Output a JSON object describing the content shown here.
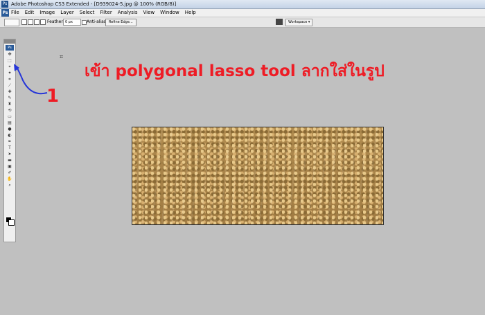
{
  "window": {
    "title": "Adobe Photoshop CS3 Extended - [D939024-5.jpg @ 100% (RGB/8)]",
    "app_badge": "Ps"
  },
  "menu": {
    "items": [
      "File",
      "Edit",
      "Image",
      "Layer",
      "Select",
      "Filter",
      "Analysis",
      "View",
      "Window",
      "Help"
    ]
  },
  "options": {
    "feather_label": "Feather:",
    "feather_value": "0 px",
    "anti_alias_label": "Anti-alias",
    "anti_alias_checked": true,
    "refine_edge_label": "Refine Edge...",
    "workspace_label": "Workspace ▾"
  },
  "toolbox": {
    "badge": "Ps",
    "tools": [
      "move-tool",
      "marquee-tool",
      "polygonal-lasso-tool",
      "magic-wand-tool",
      "crop-tool",
      "slice-tool",
      "healing-brush-tool",
      "brush-tool",
      "clone-stamp-tool",
      "history-brush-tool",
      "eraser-tool",
      "gradient-tool",
      "blur-tool",
      "dodge-tool",
      "pen-tool",
      "type-tool",
      "path-selection-tool",
      "shape-tool",
      "notes-tool",
      "eyedropper-tool",
      "hand-tool",
      "zoom-tool"
    ],
    "foreground_color": "#000000",
    "background_color": "#ffffff"
  },
  "annotation": {
    "headline": "เข้า polygonal lasso tool ลากใส่ในรูป",
    "step_number": "1",
    "color": "#ee1c25"
  },
  "document": {
    "name": "D939024-5.jpg",
    "zoom": "100%",
    "mode": "RGB/8"
  }
}
